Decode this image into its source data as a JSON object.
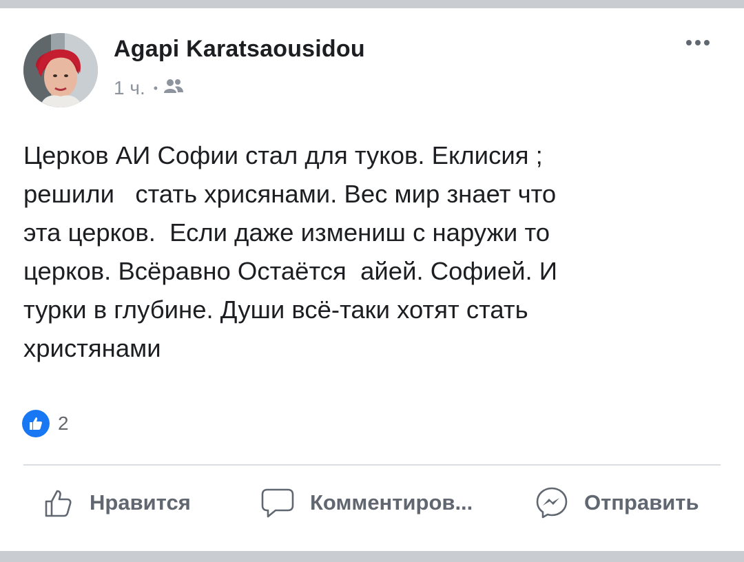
{
  "post": {
    "author": "Agapi Karatsaousidou",
    "time": "1 ч.",
    "separator": "•",
    "audience_icon": "friends-icon",
    "text_lines": [
      "Церков АИ Софии стал для туков. Еклисия ;",
      "решили   стать хрисянами. Вес мир знает что",
      "эта церков.  Если даже измениш с наружи то",
      "церков. Всёравно Остаётся  айей. Софией. И",
      "турки в глубине. Души всё-таки хотят стать",
      "христянами"
    ],
    "reaction_icon": "like-reaction-icon",
    "reaction_count": "2"
  },
  "actions": {
    "like_label": "Нравится",
    "comment_label": "Комментиров...",
    "share_label": "Отправить"
  },
  "colors": {
    "accent": "#1877f2",
    "text": "#1c1e21",
    "muted": "#606770",
    "background": "#c9ccd1"
  }
}
